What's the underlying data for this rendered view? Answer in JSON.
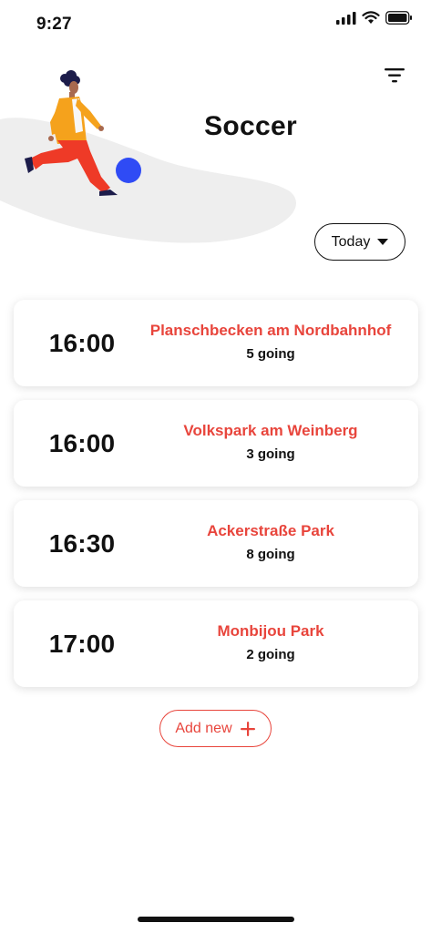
{
  "status_bar": {
    "time": "9:27"
  },
  "header": {
    "title": "Soccer"
  },
  "filter": {
    "selected": "Today"
  },
  "sessions": [
    {
      "time": "16:00",
      "place": "Planschbecken am Nordbahnhof",
      "going": "5 going"
    },
    {
      "time": "16:00",
      "place": "Volkspark am Weinberg",
      "going": "3 going"
    },
    {
      "time": "16:30",
      "place": "Ackerstraße Park",
      "going": "8 going"
    },
    {
      "time": "17:00",
      "place": "Monbijou Park",
      "going": "2 going"
    }
  ],
  "add_button": {
    "label": "Add new"
  },
  "colors": {
    "accent": "#e8453c",
    "ball": "#2f4bf5",
    "blob": "#eeeeee",
    "text": "#111111"
  }
}
